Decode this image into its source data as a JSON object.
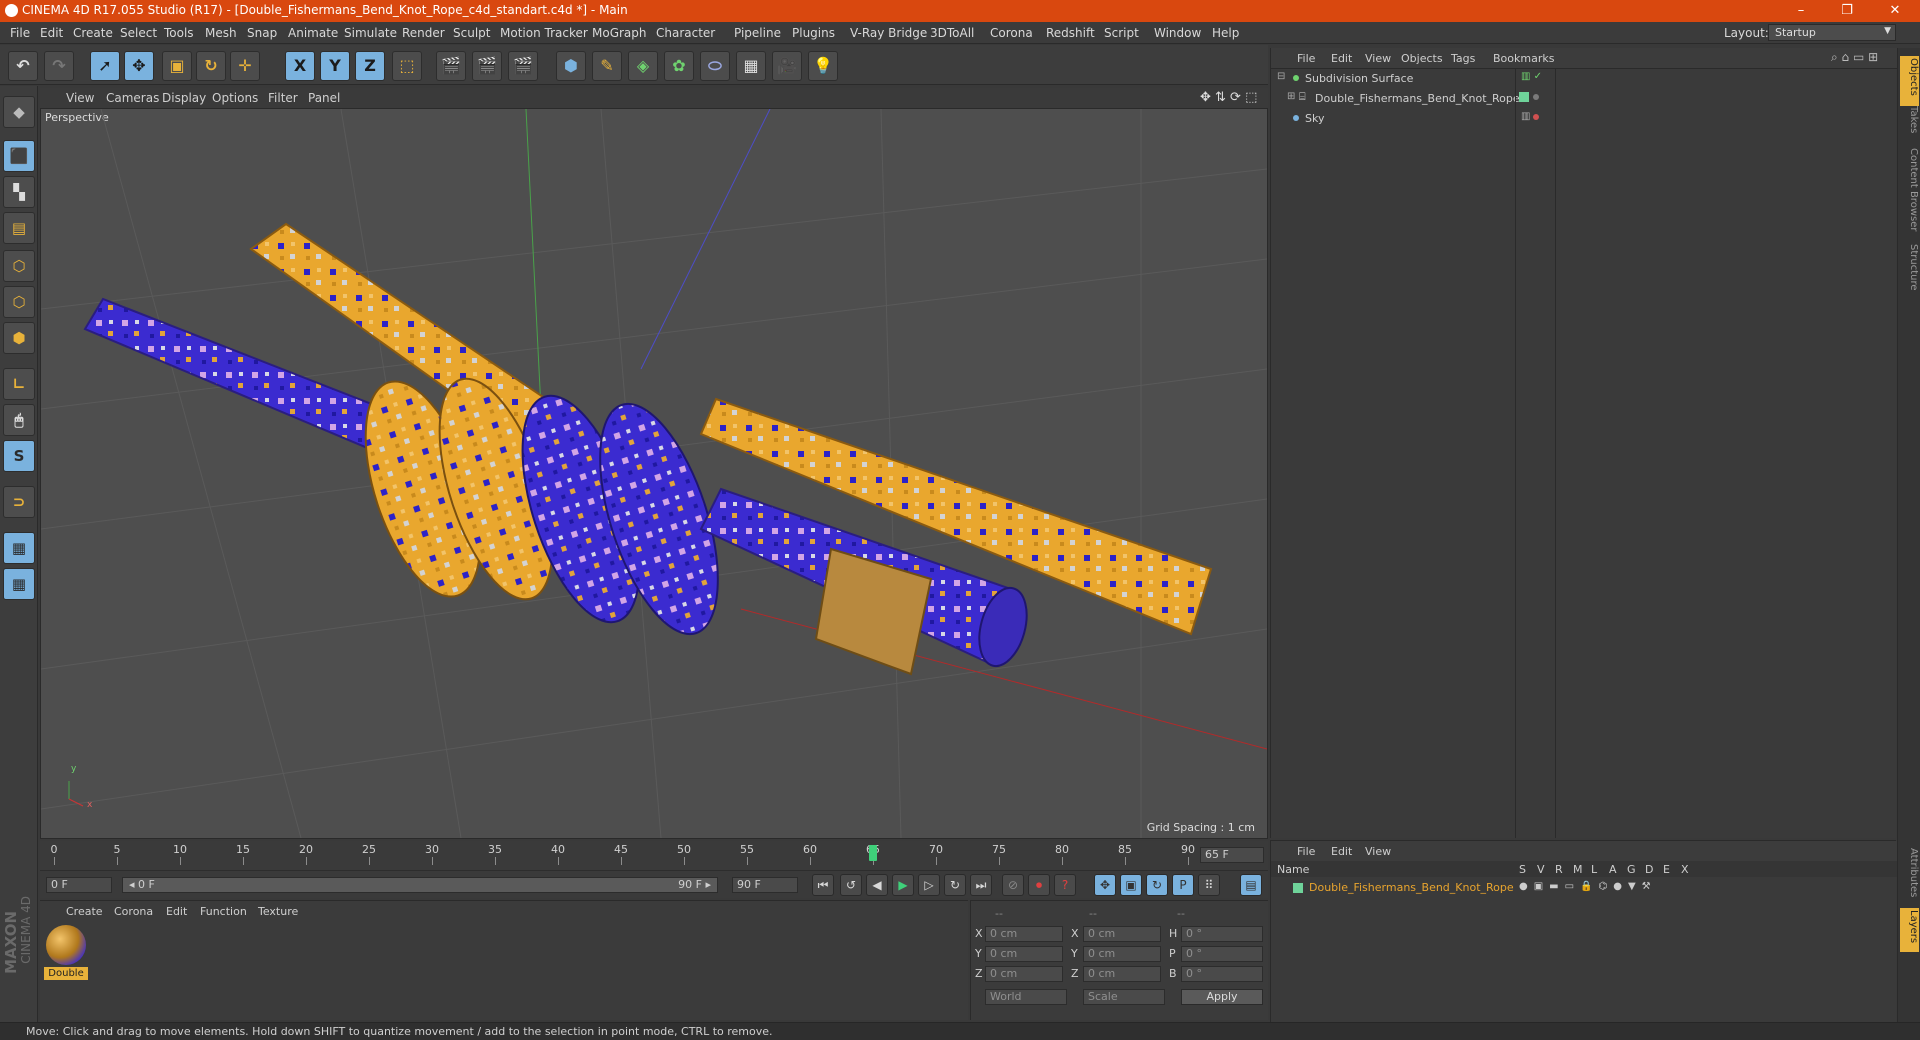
{
  "app": {
    "window_title": "CINEMA 4D R17.055 Studio (R17) - [Double_Fishermans_Bend_Knot_Rope_c4d_standart.c4d *] - Main",
    "layout_label": "Layout:",
    "layout_value": "Startup",
    "win_minimize": "–",
    "win_restore": "❐",
    "win_close": "✕"
  },
  "menubar": [
    "File",
    "Edit",
    "Create",
    "Select",
    "Tools",
    "Mesh",
    "Snap",
    "Animate",
    "Simulate",
    "Render",
    "Sculpt",
    "Motion Tracker",
    "MoGraph",
    "Character",
    "Pipeline",
    "Plugins",
    "V-Ray Bridge",
    "3DToAll",
    "Corona",
    "Redshift",
    "Script",
    "Window",
    "Help"
  ],
  "toolbar": {
    "x": "X",
    "y": "Y",
    "z": "Z"
  },
  "viewport": {
    "menu": [
      "View",
      "Cameras",
      "Display",
      "Options",
      "Filter",
      "Panel"
    ],
    "label": "Perspective",
    "grid_spacing": "Grid Spacing : 1 cm",
    "axis_x": "x",
    "axis_y": "y"
  },
  "timeline": {
    "ticks": [
      "0",
      "5",
      "10",
      "15",
      "20",
      "25",
      "30",
      "35",
      "40",
      "45",
      "50",
      "55",
      "60",
      "65",
      "70",
      "75",
      "80",
      "85",
      "90"
    ],
    "current_frame": 65,
    "end_field": "65 F",
    "start_field": "0 F",
    "range_left": "◂ 0 F",
    "range_right": "90 F ▸",
    "max_field": "90 F"
  },
  "material_panel": {
    "menu": [
      "Create",
      "Corona",
      "Edit",
      "Function",
      "Texture"
    ],
    "material_name": "Double"
  },
  "coord_panel": {
    "header": [
      "--",
      "--",
      "--"
    ],
    "rows": [
      {
        "a": "X",
        "av": "0 cm",
        "b": "X",
        "bv": "0 cm",
        "c": "H",
        "cv": "0 °"
      },
      {
        "a": "Y",
        "av": "0 cm",
        "b": "Y",
        "bv": "0 cm",
        "c": "P",
        "cv": "0 °"
      },
      {
        "a": "Z",
        "av": "0 cm",
        "b": "Z",
        "bv": "0 cm",
        "c": "B",
        "cv": "0 °"
      }
    ],
    "world": "World",
    "scale": "Scale",
    "apply": "Apply"
  },
  "object_manager": {
    "menu": [
      "File",
      "Edit",
      "View",
      "Objects",
      "Tags",
      "Bookmarks"
    ],
    "objects": [
      "Subdivision Surface",
      "Double_Fishermans_Bend_Knot_Rope",
      "Sky"
    ]
  },
  "layer_manager": {
    "menu": [
      "File",
      "Edit",
      "View"
    ],
    "name_header": "Name",
    "columns": [
      "S",
      "V",
      "R",
      "M",
      "L",
      "A",
      "G",
      "D",
      "E",
      "X"
    ],
    "layer_name": "Double_Fishermans_Bend_Knot_Rope"
  },
  "right_tabs": [
    "Objects",
    "Takes",
    "Content Browser",
    "Structure",
    "Attributes",
    "Layers"
  ],
  "status": "Move: Click and drag to move elements. Hold down SHIFT to quantize movement / add to the selection in point mode, CTRL to remove.",
  "brand": {
    "line1": "MAXON",
    "line2": "CINEMA 4D"
  },
  "colors": {
    "title_bar": "#d9480f",
    "accent_orange": "#e8b23a",
    "selected_blue": "#7ab2de"
  }
}
